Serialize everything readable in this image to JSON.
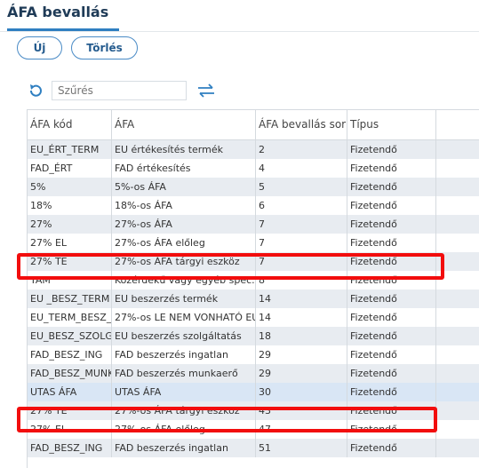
{
  "page": {
    "title": "ÁFA bevallás"
  },
  "toolbar": {
    "new_label": "Új",
    "delete_label": "Törlés"
  },
  "filter": {
    "placeholder": "Szűrés"
  },
  "colors": {
    "accent": "#2f7fc1",
    "highlight": "#f20d0d",
    "row_alt": "#e8ecf1",
    "row_selected": "#d9e6f5"
  },
  "table": {
    "headers": [
      "ÁFA kód",
      "ÁFA",
      "ÁFA bevallás sor",
      "Típus"
    ],
    "rows": [
      {
        "code": "EU_ÉRT_TERM",
        "name": "EU értékesítés termék",
        "line": "2",
        "type": "Fizetendő"
      },
      {
        "code": "FAD_ÉRT",
        "name": "FAD értékesítés",
        "line": "4",
        "type": "Fizetendő"
      },
      {
        "code": "5%",
        "name": "5%-os ÁFA",
        "line": "5",
        "type": "Fizetendő"
      },
      {
        "code": "18%",
        "name": "18%-os ÁFA",
        "line": "6",
        "type": "Fizetendő"
      },
      {
        "code": "27%",
        "name": "27%-os ÁFA",
        "line": "7",
        "type": "Fizetendő"
      },
      {
        "code": "27% EL",
        "name": "27%-os ÁFA előleg",
        "line": "7",
        "type": "Fizetendő"
      },
      {
        "code": "27% TE",
        "name": "27%-os ÁFA tárgyi eszköz",
        "line": "7",
        "type": "Fizetendő"
      },
      {
        "code": "TAM",
        "name": "Közérdekű vagy egyéb spec. jel",
        "line": "8",
        "type": "Fizetendő"
      },
      {
        "code": "EU _BESZ_TERM",
        "name": "EU beszerzés termék",
        "line": "14",
        "type": "Fizetendő"
      },
      {
        "code": "EU_TERM_BESZ_LEVON",
        "name": "27%-os LE NEM VONHATÓ EU",
        "line": "14",
        "type": "Fizetendő"
      },
      {
        "code": "EU_BESZ_SZOLG",
        "name": "EU beszerzés szolgáltatás",
        "line": "18",
        "type": "Fizetendő"
      },
      {
        "code": "FAD_BESZ_ING",
        "name": "FAD beszerzés ingatlan",
        "line": "29",
        "type": "Fizetendő"
      },
      {
        "code": "FAD_BESZ_MUNKAERŐ",
        "name": "FAD beszerzés munkaerő",
        "line": "29",
        "type": "Fizetendő"
      },
      {
        "code": "UTAS ÁFA",
        "name": "UTAS ÁFA",
        "line": "30",
        "type": "Fizetendő"
      },
      {
        "code": "27% TE",
        "name": "27%-os ÁFA tárgyi eszköz",
        "line": "43",
        "type": "Fizetendő"
      },
      {
        "code": "27% EL",
        "name": "27%-os ÁFA előleg",
        "line": "47",
        "type": "Fizetendő"
      },
      {
        "code": "FAD_BESZ_ING",
        "name": "FAD beszerzés ingatlan",
        "line": "51",
        "type": "Fizetendő"
      }
    ]
  }
}
